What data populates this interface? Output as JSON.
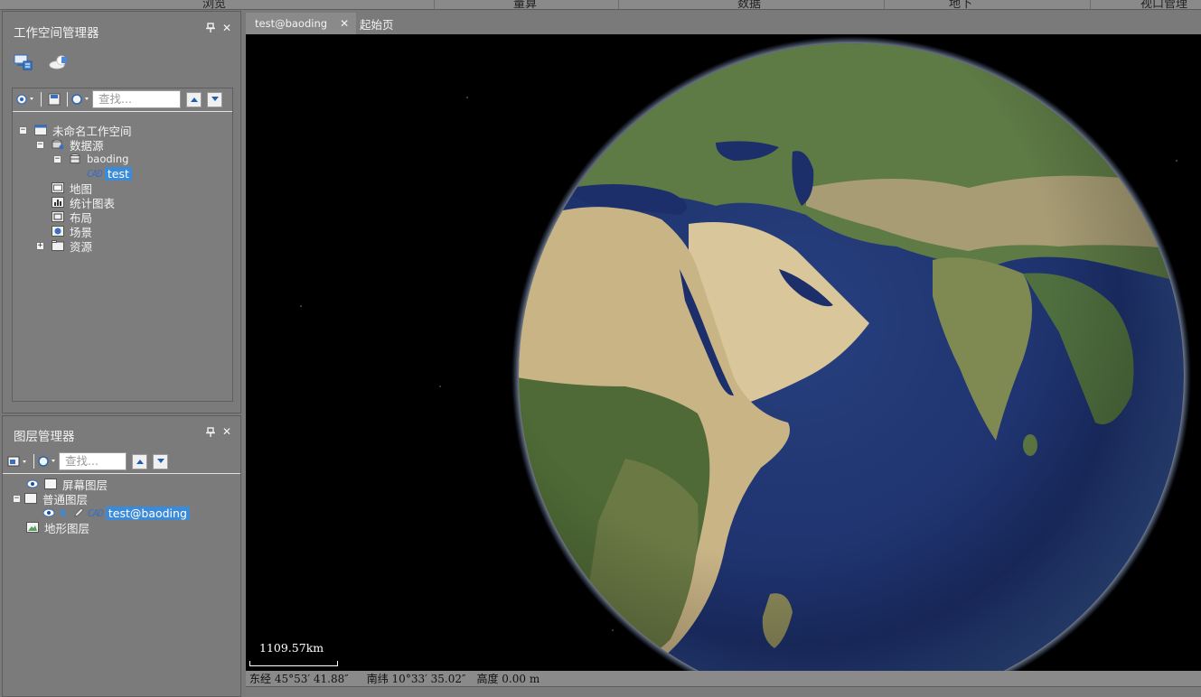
{
  "ribbon": {
    "groups": [
      "浏览",
      "量算",
      "数据",
      "地下",
      "视口管理"
    ]
  },
  "workspace_panel": {
    "title": "工作空间管理器",
    "search_placeholder": "查找...",
    "tree": {
      "root": "未命名工作空间",
      "datasources": "数据源",
      "datasource": "baoding",
      "dataset": "test",
      "maps": "地图",
      "charts": "统计图表",
      "layouts": "布局",
      "scenes": "场景",
      "resources": "资源"
    }
  },
  "layer_panel": {
    "title": "图层管理器",
    "search_placeholder": "查找...",
    "tree": {
      "screen_layer": "屏幕图层",
      "normal_layer": "普通图层",
      "layer_item": "test@baoding",
      "terrain_layer": "地形图层"
    }
  },
  "doc_tabs": [
    {
      "label": "test@baoding",
      "close": "✕"
    },
    {
      "label": "起始页"
    }
  ],
  "scale": {
    "label": "1109.57km"
  },
  "status": {
    "lon": "东经 45°53′ 41.88″",
    "lat": "南纬 10°33′ 35.02″",
    "alt": "高度 0.00 m"
  },
  "icons": [
    "pin-icon",
    "close-icon",
    "workspace-tab-icon",
    "scene-tab-icon",
    "dropdown-icon",
    "eye-icon",
    "edit-icon",
    "select-icon"
  ]
}
